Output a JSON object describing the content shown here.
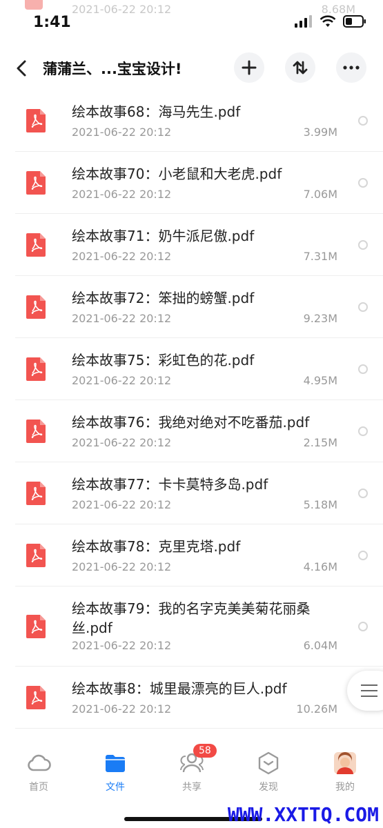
{
  "status_bar": {
    "time": "1:41"
  },
  "ghost_row": {
    "date": "2021-06-22 20:12",
    "size": "8.68M"
  },
  "navbar": {
    "title": "蒲蒲兰、...宝宝设计!"
  },
  "files": [
    {
      "name": "绘本故事68：海马先生.pdf",
      "date": "2021-06-22 20:12",
      "size": "3.99M"
    },
    {
      "name": "绘本故事70：小老鼠和大老虎.pdf",
      "date": "2021-06-22 20:12",
      "size": "7.06M"
    },
    {
      "name": "绘本故事71：奶牛派尼傲.pdf",
      "date": "2021-06-22 20:12",
      "size": "7.31M"
    },
    {
      "name": "绘本故事72：笨拙的螃蟹.pdf",
      "date": "2021-06-22 20:12",
      "size": "9.23M"
    },
    {
      "name": "绘本故事75：彩虹色的花.pdf",
      "date": "2021-06-22 20:12",
      "size": "4.95M"
    },
    {
      "name": "绘本故事76：我绝对绝对不吃番茄.pdf",
      "date": "2021-06-22 20:12",
      "size": "2.15M"
    },
    {
      "name": "绘本故事77：卡卡莫特多岛.pdf",
      "date": "2021-06-22 20:12",
      "size": "5.18M"
    },
    {
      "name": "绘本故事78：克里克塔.pdf",
      "date": "2021-06-22 20:12",
      "size": "4.16M"
    },
    {
      "name": "绘本故事79：我的名字克美美菊花丽桑丝.pdf",
      "date": "2021-06-22 20:12",
      "size": "6.04M"
    },
    {
      "name": "绘本故事8：城里最漂亮的巨人.pdf",
      "date": "2021-06-22 20:12",
      "size": "10.26M"
    }
  ],
  "tabbar": {
    "home": "首页",
    "files": "文件",
    "share": "共享",
    "share_badge": "58",
    "discover": "发现",
    "me": "我的"
  },
  "watermark": "WWW.XXTTQ.COM",
  "colors": {
    "accent": "#1a7cf5",
    "pdf_red": "#f25450",
    "badge": "#f24a45"
  }
}
